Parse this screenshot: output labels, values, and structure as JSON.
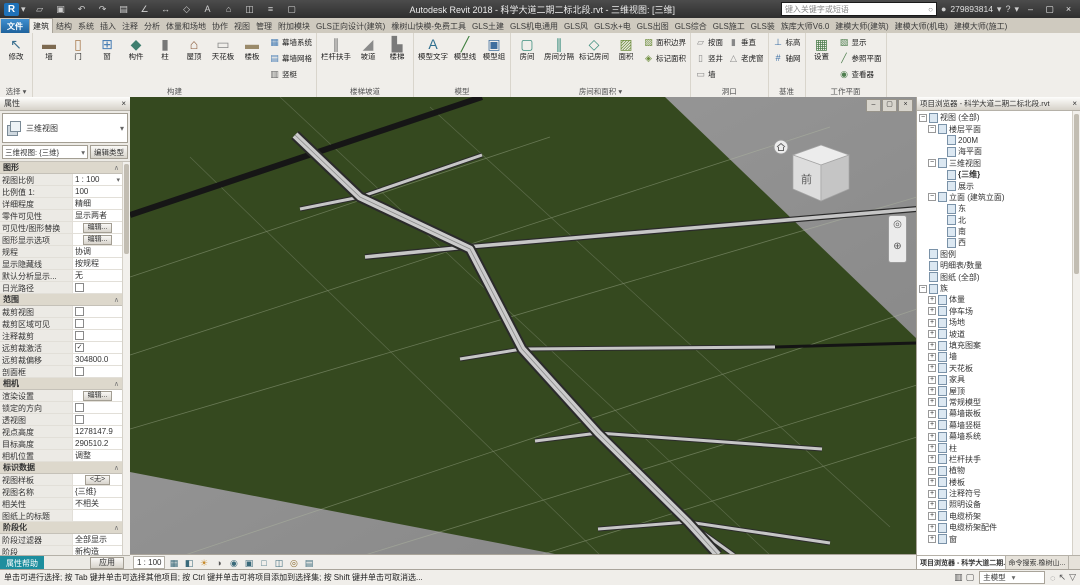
{
  "colors": {
    "titlebar_bg": "#3c3c3c",
    "accent_blue": "#1e71b8",
    "terrain_green": "#35491f",
    "viewport_bg": "#8f8f8f",
    "help_teal": "#1d8e9e"
  },
  "titlebar": {
    "title": "Autodesk Revit 2018 - 科学大道二期二标北段.rvt - 三维视图: [三维]",
    "search_placeholder": "键入关键字或短语",
    "user_id": "279893814",
    "quick_access": [
      "open",
      "save",
      "undo",
      "redo",
      "print",
      "measure",
      "dimension",
      "tag",
      "text-note",
      "3d-home",
      "section",
      "thin-lines",
      "switch-windows"
    ],
    "right_icons": [
      "search",
      "user"
    ],
    "window_icons": [
      "minimize",
      "maximize",
      "close"
    ]
  },
  "ribbon_tabs": [
    "文件",
    "建筑",
    "结构",
    "系统",
    "插入",
    "注释",
    "分析",
    "体量和场地",
    "协作",
    "视图",
    "管理",
    "附加模块",
    "GLS正向设计(建筑)",
    "橡树山快模-免费工具",
    "GLS土建",
    "GLS机电通用",
    "GLS风",
    "GLS水+电",
    "GLS出图",
    "GLS综合",
    "GLS施工",
    "GLS装",
    "族库大师V6.0",
    "建模大师(建筑)",
    "建模大师(机电)",
    "建模大师(施工)"
  ],
  "active_tab": "建筑",
  "ribbon": {
    "groups": [
      {
        "label": "选择 ▾",
        "buttons": [
          {
            "label": "修改",
            "icon": "modify"
          }
        ]
      },
      {
        "label": "构建",
        "buttons": [
          {
            "label": "墙",
            "icon": "wall"
          },
          {
            "label": "门",
            "icon": "door"
          },
          {
            "label": "窗",
            "icon": "window-el"
          },
          {
            "label": "构件",
            "icon": "component"
          },
          {
            "label": "柱",
            "icon": "column"
          },
          {
            "label": "屋顶",
            "icon": "roof"
          },
          {
            "label": "天花板",
            "icon": "ceiling"
          },
          {
            "label": "楼板",
            "icon": "floor"
          },
          {
            "label": "幕墙系统",
            "icon": "curtain-system",
            "small": true
          },
          {
            "label": "幕墙网格",
            "icon": "curtain-grid",
            "small": true
          },
          {
            "label": "竖梃",
            "icon": "mullion",
            "small": true
          }
        ]
      },
      {
        "label": "楼梯坡道",
        "buttons": [
          {
            "label": "栏杆扶手",
            "icon": "railing"
          },
          {
            "label": "坡道",
            "icon": "ramp"
          },
          {
            "label": "楼梯",
            "icon": "stair"
          }
        ]
      },
      {
        "label": "模型",
        "buttons": [
          {
            "label": "模型文字",
            "icon": "model-text"
          },
          {
            "label": "模型线",
            "icon": "model-line"
          },
          {
            "label": "模型组",
            "icon": "model-group"
          }
        ]
      },
      {
        "label": "房间和面积 ▾",
        "buttons": [
          {
            "label": "房间",
            "icon": "room"
          },
          {
            "label": "房间分隔",
            "icon": "room-separator"
          },
          {
            "label": "标记房间",
            "icon": "tag-room"
          },
          {
            "label": "面积",
            "icon": "area"
          },
          {
            "label": "面积边界",
            "icon": "area-boundary",
            "small": true
          },
          {
            "label": "标记面积",
            "icon": "tag-area",
            "small": true
          }
        ]
      },
      {
        "label": "洞口",
        "buttons": [
          {
            "label": "按面",
            "icon": "opening-face",
            "small": true
          },
          {
            "label": "竖井",
            "icon": "opening-shaft",
            "small": true
          },
          {
            "label": "墙",
            "icon": "opening-wall",
            "small": true
          },
          {
            "label": "垂直",
            "icon": "opening-vertical",
            "small": true
          },
          {
            "label": "老虎窗",
            "icon": "opening-dormer",
            "small": true
          }
        ]
      },
      {
        "label": "基准",
        "buttons": [
          {
            "label": "标高",
            "icon": "level",
            "small": true
          },
          {
            "label": "轴网",
            "icon": "grid",
            "small": true
          }
        ]
      },
      {
        "label": "工作平面",
        "buttons": [
          {
            "label": "设置",
            "icon": "set-plane"
          },
          {
            "label": "显示",
            "icon": "show-plane",
            "small": true
          },
          {
            "label": "参照平面",
            "icon": "ref-plane",
            "small": true
          },
          {
            "label": "查看器",
            "icon": "viewer",
            "small": true
          }
        ]
      }
    ]
  },
  "properties": {
    "title": "属性",
    "type_selector": "三维视图",
    "view_selector": "三维视图: {三维}",
    "edit_type_label": "编辑类型",
    "sections": [
      {
        "name": "图形",
        "rows": [
          {
            "label": "视图比例",
            "value": "1 : 100",
            "kind": "dropdown"
          },
          {
            "label": "比例值 1:",
            "value": "100"
          },
          {
            "label": "详细程度",
            "value": "精细"
          },
          {
            "label": "零件可见性",
            "value": "显示两者"
          },
          {
            "label": "可见性/图形替换",
            "value": "编辑...",
            "kind": "button"
          },
          {
            "label": "图形显示选项",
            "value": "编辑...",
            "kind": "button"
          },
          {
            "label": "规程",
            "value": "协调"
          },
          {
            "label": "显示隐藏线",
            "value": "按规程"
          },
          {
            "label": "默认分析显示...",
            "value": "无"
          },
          {
            "label": "日光路径",
            "kind": "checkbox",
            "checked": false
          }
        ]
      },
      {
        "name": "范围",
        "rows": [
          {
            "label": "裁剪视图",
            "kind": "checkbox",
            "checked": false
          },
          {
            "label": "裁剪区域可见",
            "kind": "checkbox",
            "checked": false
          },
          {
            "label": "注释裁剪",
            "kind": "checkbox",
            "checked": false
          },
          {
            "label": "远剪裁激活",
            "kind": "checkbox",
            "checked": true
          },
          {
            "label": "远剪裁偏移",
            "value": "304800.0"
          },
          {
            "label": "剖面框",
            "kind": "checkbox",
            "checked": false
          }
        ]
      },
      {
        "name": "相机",
        "rows": [
          {
            "label": "渲染设置",
            "value": "编辑...",
            "kind": "button"
          },
          {
            "label": "锁定的方向",
            "kind": "checkbox",
            "checked": false
          },
          {
            "label": "透视图",
            "kind": "checkbox",
            "checked": false
          },
          {
            "label": "视点高度",
            "value": "1278147.9"
          },
          {
            "label": "目标高度",
            "value": "290510.2"
          },
          {
            "label": "相机位置",
            "value": "调整"
          }
        ]
      },
      {
        "name": "标识数据",
        "rows": [
          {
            "label": "视图样板",
            "value": "<无>",
            "kind": "button"
          },
          {
            "label": "视图名称",
            "value": "{三维}"
          },
          {
            "label": "相关性",
            "value": "不相关"
          },
          {
            "label": "图纸上的标题",
            "value": ""
          }
        ]
      },
      {
        "name": "阶段化",
        "rows": [
          {
            "label": "阶段过滤器",
            "value": "全部显示"
          },
          {
            "label": "阶段",
            "value": "新构造"
          }
        ]
      }
    ],
    "footer": {
      "help": "属性帮助",
      "apply": "应用"
    }
  },
  "viewport": {
    "scale_label": "1 : 100",
    "viewcube_label": "前",
    "window_controls": [
      "view-minimize",
      "view-restore",
      "view-close"
    ],
    "control_icons": [
      "detail-level",
      "visual-style",
      "sun-path",
      "shadows",
      "render",
      "crop-view",
      "show-crop",
      "temp-hide",
      "reveal-hidden",
      "temp-view-props"
    ],
    "navbar_icons": [
      "nav-wheel",
      "nav-zoom"
    ]
  },
  "browser": {
    "title": "项目浏览器 - 科学大道二期二标北段.rvt",
    "tree": [
      {
        "t": "视图 (全部)",
        "d": 0,
        "k": "open"
      },
      {
        "t": "楼层平面",
        "d": 1,
        "k": "open"
      },
      {
        "t": "200M",
        "d": 2,
        "k": "leaf"
      },
      {
        "t": "海平面",
        "d": 2,
        "k": "leaf"
      },
      {
        "t": "三维视图",
        "d": 1,
        "k": "open"
      },
      {
        "t": "{三维}",
        "d": 2,
        "k": "leaf",
        "b": true
      },
      {
        "t": "展示",
        "d": 2,
        "k": "leaf"
      },
      {
        "t": "立面 (建筑立面)",
        "d": 1,
        "k": "open"
      },
      {
        "t": "东",
        "d": 2,
        "k": "leaf"
      },
      {
        "t": "北",
        "d": 2,
        "k": "leaf"
      },
      {
        "t": "南",
        "d": 2,
        "k": "leaf"
      },
      {
        "t": "西",
        "d": 2,
        "k": "leaf"
      },
      {
        "t": "图例",
        "d": 0,
        "k": "leaf"
      },
      {
        "t": "明细表/数量",
        "d": 0,
        "k": "leaf"
      },
      {
        "t": "图纸 (全部)",
        "d": 0,
        "k": "leaf"
      },
      {
        "t": "族",
        "d": 0,
        "k": "open"
      },
      {
        "t": "体量",
        "d": 1,
        "k": "closed"
      },
      {
        "t": "停车场",
        "d": 1,
        "k": "closed"
      },
      {
        "t": "场地",
        "d": 1,
        "k": "closed"
      },
      {
        "t": "坡道",
        "d": 1,
        "k": "closed"
      },
      {
        "t": "填充图案",
        "d": 1,
        "k": "closed"
      },
      {
        "t": "墙",
        "d": 1,
        "k": "closed"
      },
      {
        "t": "天花板",
        "d": 1,
        "k": "closed"
      },
      {
        "t": "家具",
        "d": 1,
        "k": "closed"
      },
      {
        "t": "屋顶",
        "d": 1,
        "k": "closed"
      },
      {
        "t": "常规模型",
        "d": 1,
        "k": "closed"
      },
      {
        "t": "幕墙嵌板",
        "d": 1,
        "k": "closed"
      },
      {
        "t": "幕墙竖梃",
        "d": 1,
        "k": "closed"
      },
      {
        "t": "幕墙系统",
        "d": 1,
        "k": "closed"
      },
      {
        "t": "柱",
        "d": 1,
        "k": "closed"
      },
      {
        "t": "栏杆扶手",
        "d": 1,
        "k": "closed"
      },
      {
        "t": "植物",
        "d": 1,
        "k": "closed"
      },
      {
        "t": "楼板",
        "d": 1,
        "k": "closed"
      },
      {
        "t": "注释符号",
        "d": 1,
        "k": "closed"
      },
      {
        "t": "照明设备",
        "d": 1,
        "k": "closed"
      },
      {
        "t": "电缆桥架",
        "d": 1,
        "k": "closed"
      },
      {
        "t": "电缆桥架配件",
        "d": 1,
        "k": "closed"
      },
      {
        "t": "窗",
        "d": 1,
        "k": "closed"
      }
    ],
    "tabs": [
      "项目浏览器 - 科学大道二期...",
      "命令搜索.橡树山..."
    ]
  },
  "status": {
    "message": "单击可进行选择; 按 Tab 键并单击可选择其他项目; 按 Ctrl 键并单击可将项目添加到选择集; 按 Shift 键并单击可取消选...",
    "main_model_label": "主模型",
    "left_icons": [
      "worksets",
      "design-options"
    ],
    "right_icons": [
      "exclude-options",
      "press-drag",
      "filter"
    ]
  }
}
